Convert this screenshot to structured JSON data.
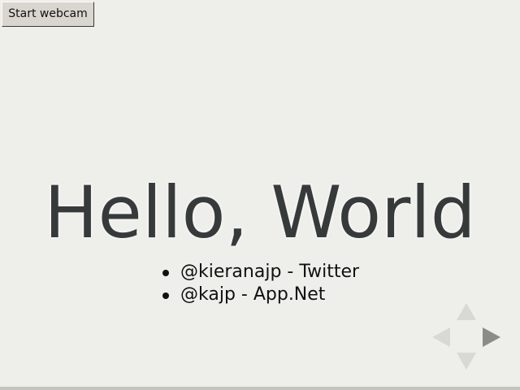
{
  "toolbar": {
    "start_webcam_label": "Start webcam"
  },
  "slide": {
    "title": "Hello, World",
    "items": [
      {
        "text": "@kieranajp - Twitter"
      },
      {
        "text": "@kajp - App.Net"
      }
    ]
  },
  "navigation": {
    "icons": [
      "nav-up-arrow-icon",
      "nav-down-arrow-icon",
      "nav-left-arrow-icon",
      "nav-right-arrow-icon"
    ],
    "enabled": {
      "up": false,
      "down": false,
      "left": false,
      "right": true
    },
    "colors": {
      "enabled": "#8c8c86",
      "disabled": "#d9d9d4"
    }
  },
  "colors": {
    "background": "#eeeeea",
    "title": "#363a3a",
    "text": "#111111",
    "button_face": "#d9d6d0"
  }
}
